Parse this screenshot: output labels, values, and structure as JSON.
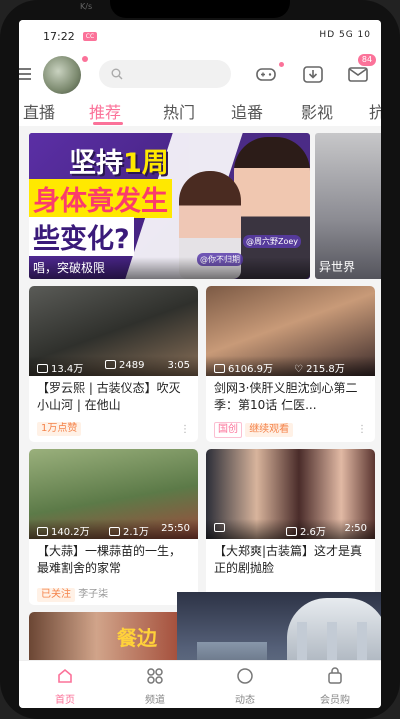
{
  "status": {
    "time": "17:22",
    "app_badge": "CC",
    "right": "HD 5G 10",
    "glimpse_text": "K/s"
  },
  "header": {
    "message_badge": "84"
  },
  "tabs": [
    {
      "label": "直播"
    },
    {
      "label": "推荐"
    },
    {
      "label": "热门"
    },
    {
      "label": "追番"
    },
    {
      "label": "影视"
    },
    {
      "label": "抗"
    }
  ],
  "banner": {
    "line1_a": "坚持",
    "line1_b": "1周",
    "line2": "身体竟发生",
    "line3": "些变化?",
    "caption": "唱，突破极限",
    "tag_a": "@你不归期",
    "tag_b": "@周六野Zoey"
  },
  "banner_side": {
    "caption": "异世界"
  },
  "cards": [
    {
      "plays": "13.4万",
      "danmaku": "2489",
      "duration": "3:05",
      "title": "【罗云熙 | 古装仪态】吹灭小山河 | 在他山",
      "tag": "1万点赞",
      "tag2": ""
    },
    {
      "plays": "6106.9万",
      "danmaku": "215.8万",
      "duration": "",
      "title": "剑网3·侠肝义胆沈剑心第二季：第10话 仁医...",
      "tag": "国创",
      "tag2": "继续观看"
    },
    {
      "plays": "140.2万",
      "danmaku": "2.1万",
      "duration": "25:50",
      "title": "【大蒜】一棵蒜苗的一生，最难割舍的家常",
      "tag": "已关注",
      "tag2": "李子柒"
    },
    {
      "plays": "",
      "danmaku": "2.6万",
      "duration": "2:50",
      "title": "【大郑爽|古装篇】这才是真正的剧抛脸",
      "tag": "",
      "tag2": ""
    }
  ],
  "partial_card_text": "餐边",
  "bottom_nav": [
    {
      "label": "首页"
    },
    {
      "label": "频道"
    },
    {
      "label": "动态"
    },
    {
      "label": "会员购"
    }
  ]
}
